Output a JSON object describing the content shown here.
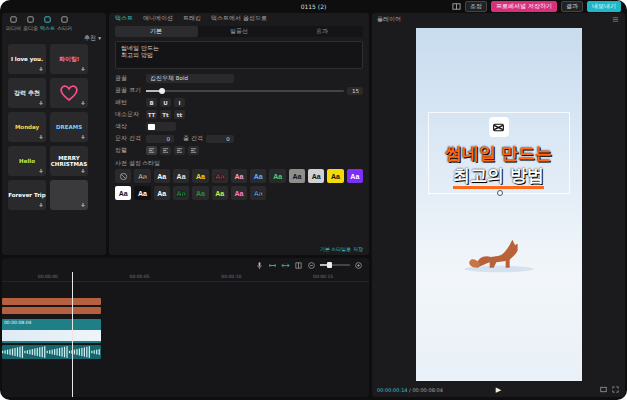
{
  "window": {
    "title": "0115 (2)"
  },
  "header_buttons": [
    {
      "label": "조정",
      "kind": "plain"
    },
    {
      "label": "프로페셔널 저장하기",
      "kind": "pink"
    },
    {
      "label": "결과",
      "kind": "plain"
    },
    {
      "label": "내보내기",
      "kind": "cyan"
    }
  ],
  "library": {
    "tabs": [
      {
        "label": "미디어",
        "selected": false
      },
      {
        "label": "오디오",
        "selected": false
      },
      {
        "label": "텍스트",
        "selected": true
      },
      {
        "label": "스티커",
        "selected": false
      }
    ],
    "filter": "추천 ▾",
    "items": [
      {
        "label": "I love you.",
        "color": "#ffffff",
        "kind": "text"
      },
      {
        "label": "화이팅!",
        "color": "#ff7aa8",
        "kind": "text"
      },
      {
        "label": "강력 추천",
        "color": "#ffffff",
        "kind": "text"
      },
      {
        "label": "",
        "color": "#ff4d8d",
        "kind": "heart"
      },
      {
        "label": "Monday",
        "color": "#ffd34d",
        "kind": "text"
      },
      {
        "label": "DREAMS",
        "color": "#6fd3ff",
        "kind": "text"
      },
      {
        "label": "Hello",
        "color": "#c6f04a",
        "kind": "text"
      },
      {
        "label": "MERRY CHRISTMAS",
        "color": "#ffffff",
        "kind": "text"
      },
      {
        "label": "Forever Trip",
        "color": "#ffffff",
        "kind": "text"
      },
      {
        "label": "",
        "color": "#3a3a3c",
        "kind": "blank"
      }
    ]
  },
  "editor": {
    "tabs": [
      {
        "label": "텍스트",
        "selected": true
      },
      {
        "label": "애니메이션",
        "selected": false
      },
      {
        "label": "트래킹",
        "selected": false
      },
      {
        "label": "텍스트에서 음성으로",
        "selected": false
      }
    ],
    "subtabs": [
      {
        "label": "기본",
        "selected": true
      },
      {
        "label": "말풍선",
        "selected": false
      },
      {
        "label": "효과",
        "selected": false
      }
    ],
    "text_lines": [
      "썸네일 만드는",
      "최고의 방법"
    ],
    "font": {
      "label": "글꼴",
      "value": "김진우체 Bold"
    },
    "size": {
      "label": "글꼴 크기",
      "level": 0.08,
      "reading": "15"
    },
    "pattern": {
      "label": "패턴",
      "buttons": [
        {
          "label": "B",
          "selected": false
        },
        {
          "label": "U",
          "selected": false
        },
        {
          "label": "I",
          "selected": false
        }
      ]
    },
    "case": {
      "label": "대소문자",
      "buttons": [
        {
          "label": "TT",
          "selected": false
        },
        {
          "label": "Tt",
          "selected": false
        },
        {
          "label": "tt",
          "selected": false
        }
      ]
    },
    "color": {
      "label": "색상",
      "value": "#ffffff"
    },
    "spacing": {
      "label": "문자 간격",
      "value": "0",
      "line_label": "줄 간격",
      "line_value": "0"
    },
    "align": {
      "label": "정렬",
      "options": [
        {
          "selected": true
        },
        {
          "selected": false
        },
        {
          "selected": false
        },
        {
          "selected": false
        }
      ]
    },
    "presets_label": "사전 설정 스타일",
    "presets": [
      {
        "label": "",
        "color": "#9a9a9a",
        "kind": "none"
      },
      {
        "label": "Aa",
        "color": "#ffffff",
        "kind": "outline"
      },
      {
        "label": "Aa",
        "color": "#ffffff",
        "kind": "plain"
      },
      {
        "label": "Aa",
        "color": "#e6e6e6",
        "kind": "plain"
      },
      {
        "label": "Aa",
        "color": "#f5d90a",
        "kind": "plain"
      },
      {
        "label": "Aa",
        "color": "#ff5a5a",
        "kind": "outline"
      },
      {
        "label": "Aa",
        "color": "#ff9ec7",
        "kind": "plain"
      },
      {
        "label": "Aa",
        "color": "#5ab0ff",
        "kind": "plain"
      },
      {
        "label": "Aa",
        "color": "#49d36b",
        "kind": "plain"
      },
      {
        "label": "Aa",
        "color": "#8e8e8e",
        "kind": "box-dark"
      },
      {
        "label": "Aa",
        "color": "#d0d0d0",
        "kind": "box-dark"
      },
      {
        "label": "Aa",
        "color": "#f5d90a",
        "kind": "box-dark"
      },
      {
        "label": "Aa",
        "color": "#7b2ff7",
        "kind": "box-light"
      },
      {
        "label": "Aa",
        "color": "#ffffff",
        "kind": "box-dark"
      },
      {
        "label": "Aa",
        "color": "#111111",
        "kind": "box-light"
      },
      {
        "label": "Aa",
        "color": "#ffffff",
        "kind": "plain"
      },
      {
        "label": "Aa",
        "color": "#3cd070",
        "kind": "outline"
      },
      {
        "label": "Aa",
        "color": "#2e8b3e",
        "kind": "plain"
      },
      {
        "label": "Aa",
        "color": "#c6f04a",
        "kind": "plain"
      },
      {
        "label": "Aa",
        "color": "#ff7ad9",
        "kind": "plain"
      },
      {
        "label": "Aa",
        "color": "#9fd8ff",
        "kind": "outline"
      }
    ],
    "save_link": "기본 스타일로 저장"
  },
  "timeline": {
    "ruler": [
      "00:00:00",
      "00:00:05",
      "00:00:10",
      "00:00:15"
    ],
    "zoom_level": 0.3,
    "playhead": 0.19,
    "tracks": [
      {
        "kind": "text",
        "color": "#b5613f",
        "label": "",
        "level": 0.27
      },
      {
        "kind": "text",
        "color": "#b5613f",
        "label": "",
        "level": 0.27
      },
      {
        "kind": "video",
        "color": "#1f7f86",
        "label": "00:00:08:04",
        "level": 0.27
      },
      {
        "kind": "audio",
        "color": "#17666e",
        "label": "",
        "level": 0.27
      }
    ]
  },
  "player": {
    "title": "플레이어",
    "current": "00:00:00:14",
    "total": "00:00:08:04",
    "play": "▶"
  }
}
